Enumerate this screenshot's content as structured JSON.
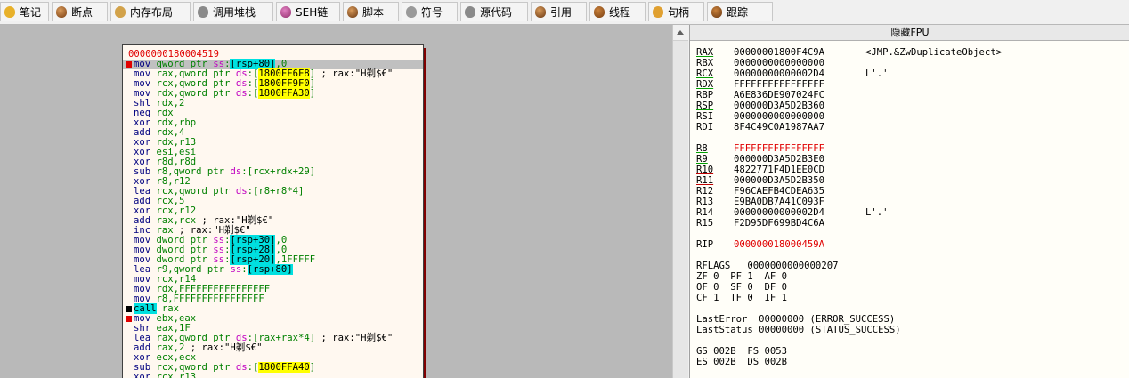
{
  "tabs": [
    {
      "label": "笔记",
      "icon": "note-icon"
    },
    {
      "label": "断点",
      "icon": "breakpoint-icon"
    },
    {
      "label": "内存布局",
      "icon": "memory-map-icon"
    },
    {
      "label": "调用堆栈",
      "icon": "call-stack-icon"
    },
    {
      "label": "SEH链",
      "icon": "seh-icon"
    },
    {
      "label": "脚本",
      "icon": "script-icon"
    },
    {
      "label": "符号",
      "icon": "symbols-icon"
    },
    {
      "label": "源代码",
      "icon": "source-icon"
    },
    {
      "label": "引用",
      "icon": "references-icon"
    },
    {
      "label": "线程",
      "icon": "threads-icon"
    },
    {
      "label": "句柄",
      "icon": "handles-icon"
    },
    {
      "label": "跟踪",
      "icon": "trace-icon"
    }
  ],
  "graph": {
    "address": "0000000180004519",
    "lines": [
      {
        "bp": "red",
        "hl": true,
        "parts": [
          [
            "mn",
            "mov "
          ],
          [
            "op",
            "qword ptr "
          ],
          [
            "sg",
            "ss"
          ],
          [
            "op",
            ":"
          ],
          [
            "br",
            "[rsp+80]"
          ],
          [
            "op",
            ",0"
          ]
        ]
      },
      {
        "parts": [
          [
            "mn",
            "mov "
          ],
          [
            "op",
            "rax,qword ptr "
          ],
          [
            "sg",
            "ds"
          ],
          [
            "op",
            ":["
          ],
          [
            "yl",
            "1800FF6F8"
          ],
          [
            "op",
            "]"
          ],
          [
            "cm",
            " ; rax:\"H剃$€\""
          ]
        ]
      },
      {
        "parts": [
          [
            "mn",
            "mov "
          ],
          [
            "op",
            "rcx,qword ptr "
          ],
          [
            "sg",
            "ds"
          ],
          [
            "op",
            ":["
          ],
          [
            "yl",
            "1800FF9F0"
          ],
          [
            "op",
            "]"
          ]
        ]
      },
      {
        "parts": [
          [
            "mn",
            "mov "
          ],
          [
            "op",
            "rdx,qword ptr "
          ],
          [
            "sg",
            "ds"
          ],
          [
            "op",
            ":["
          ],
          [
            "yl",
            "1800FFA30"
          ],
          [
            "op",
            "]"
          ]
        ]
      },
      {
        "parts": [
          [
            "mn",
            "shl "
          ],
          [
            "op",
            "rdx,2"
          ]
        ]
      },
      {
        "parts": [
          [
            "mn",
            "neg "
          ],
          [
            "op",
            "rdx"
          ]
        ]
      },
      {
        "parts": [
          [
            "mn",
            "xor "
          ],
          [
            "op",
            "rdx,rbp"
          ]
        ]
      },
      {
        "parts": [
          [
            "mn",
            "add "
          ],
          [
            "op",
            "rdx,4"
          ]
        ]
      },
      {
        "parts": [
          [
            "mn",
            "xor "
          ],
          [
            "op",
            "rdx,r13"
          ]
        ]
      },
      {
        "parts": [
          [
            "mn",
            "xor "
          ],
          [
            "op",
            "esi,esi"
          ]
        ]
      },
      {
        "parts": [
          [
            "mn",
            "xor "
          ],
          [
            "op",
            "r8d,r8d"
          ]
        ]
      },
      {
        "parts": [
          [
            "mn",
            "sub "
          ],
          [
            "op",
            "r8,qword ptr "
          ],
          [
            "sg",
            "ds"
          ],
          [
            "op",
            ":[rcx+rdx+29]"
          ]
        ]
      },
      {
        "parts": [
          [
            "mn",
            "xor "
          ],
          [
            "op",
            "r8,r12"
          ]
        ]
      },
      {
        "parts": [
          [
            "mn",
            "lea "
          ],
          [
            "op",
            "rcx,qword ptr "
          ],
          [
            "sg",
            "ds"
          ],
          [
            "op",
            ":[r8+r8*4]"
          ]
        ]
      },
      {
        "parts": [
          [
            "mn",
            "add "
          ],
          [
            "op",
            "rcx,5"
          ]
        ]
      },
      {
        "parts": [
          [
            "mn",
            "xor "
          ],
          [
            "op",
            "rcx,r12"
          ]
        ]
      },
      {
        "parts": [
          [
            "mn",
            "add "
          ],
          [
            "op",
            "rax,rcx"
          ],
          [
            "cm",
            " ; rax:\"H剃$€\""
          ]
        ]
      },
      {
        "parts": [
          [
            "mn",
            "inc "
          ],
          [
            "op",
            "rax"
          ],
          [
            "cm",
            " ; rax:\"H剃$€\""
          ]
        ]
      },
      {
        "parts": [
          [
            "mn",
            "mov "
          ],
          [
            "op",
            "dword ptr "
          ],
          [
            "sg",
            "ss"
          ],
          [
            "op",
            ":"
          ],
          [
            "br",
            "[rsp+30]"
          ],
          [
            "op",
            ",0"
          ]
        ]
      },
      {
        "parts": [
          [
            "mn",
            "mov "
          ],
          [
            "op",
            "dword ptr "
          ],
          [
            "sg",
            "ss"
          ],
          [
            "op",
            ":"
          ],
          [
            "br",
            "[rsp+28]"
          ],
          [
            "op",
            ",0"
          ]
        ]
      },
      {
        "parts": [
          [
            "mn",
            "mov "
          ],
          [
            "op",
            "dword ptr "
          ],
          [
            "sg",
            "ss"
          ],
          [
            "op",
            ":"
          ],
          [
            "br",
            "[rsp+20]"
          ],
          [
            "op",
            ",1FFFFF"
          ]
        ]
      },
      {
        "parts": [
          [
            "mn",
            "lea "
          ],
          [
            "op",
            "r9,qword ptr "
          ],
          [
            "sg",
            "ss"
          ],
          [
            "op",
            ":"
          ],
          [
            "br",
            "[rsp+80]"
          ]
        ]
      },
      {
        "parts": [
          [
            "mn",
            "mov "
          ],
          [
            "op",
            "rcx,r14"
          ]
        ]
      },
      {
        "parts": [
          [
            "mn",
            "mov "
          ],
          [
            "op",
            "rdx,FFFFFFFFFFFFFFFF"
          ]
        ]
      },
      {
        "parts": [
          [
            "mn",
            "mov "
          ],
          [
            "op",
            "r8,FFFFFFFFFFFFFFFF"
          ]
        ]
      },
      {
        "bp": "blk",
        "parts": [
          [
            "call",
            "call"
          ],
          [
            "op",
            " rax"
          ]
        ]
      },
      {
        "bp": "red",
        "parts": [
          [
            "mn",
            "mov "
          ],
          [
            "op",
            "ebx,eax"
          ]
        ]
      },
      {
        "parts": [
          [
            "mn",
            "shr "
          ],
          [
            "op",
            "eax,1F"
          ]
        ]
      },
      {
        "parts": [
          [
            "mn",
            "lea "
          ],
          [
            "op",
            "rax,qword ptr "
          ],
          [
            "sg",
            "ds"
          ],
          [
            "op",
            ":[rax+rax*4]"
          ],
          [
            "cm",
            " ; rax:\"H剃$€\""
          ]
        ]
      },
      {
        "parts": [
          [
            "mn",
            "add "
          ],
          [
            "op",
            "rax,2"
          ],
          [
            "cm",
            " ; rax:\"H剃$€\""
          ]
        ]
      },
      {
        "parts": [
          [
            "mn",
            "xor "
          ],
          [
            "op",
            "ecx,ecx"
          ]
        ]
      },
      {
        "parts": [
          [
            "mn",
            "sub "
          ],
          [
            "op",
            "rcx,qword ptr "
          ],
          [
            "sg",
            "ds"
          ],
          [
            "op",
            ":["
          ],
          [
            "yl",
            "1800FFA40"
          ],
          [
            "op",
            "]"
          ]
        ]
      },
      {
        "parts": [
          [
            "mn",
            "xor "
          ],
          [
            "op",
            "rcx,r13"
          ]
        ]
      }
    ]
  },
  "registers": {
    "header": "隐藏FPU",
    "rows": [
      {
        "name": "RAX",
        "value": "00000001800F4C9A",
        "comment": "<JMP.&ZwDuplicateObject>",
        "ul": "green"
      },
      {
        "name": "RBX",
        "value": "0000000000000000",
        "comment": ""
      },
      {
        "name": "RCX",
        "value": "00000000000002D4",
        "comment": "L'.'",
        "ul": "green"
      },
      {
        "name": "RDX",
        "value": "FFFFFFFFFFFFFFFF",
        "comment": "",
        "ul": "green"
      },
      {
        "name": "RBP",
        "value": "A6E836DE907024FC",
        "comment": ""
      },
      {
        "name": "RSP",
        "value": "000000D3A5D2B360",
        "comment": "",
        "ul": "green"
      },
      {
        "name": "RSI",
        "value": "0000000000000000",
        "comment": ""
      },
      {
        "name": "RDI",
        "value": "8F4C49C0A1987AA7",
        "comment": ""
      },
      {
        "gap": true
      },
      {
        "name": "R8",
        "value": "FFFFFFFFFFFFFFFF",
        "comment": "",
        "ul": "green",
        "red": true
      },
      {
        "name": "R9",
        "value": "000000D3A5D2B3E0",
        "comment": "",
        "ul": "green"
      },
      {
        "name": "R10",
        "value": "4822771F4D1EE0CD",
        "comment": "",
        "ul": "red"
      },
      {
        "name": "R11",
        "value": "000000D3A5D2B350",
        "comment": "",
        "ul": "red"
      },
      {
        "name": "R12",
        "value": "F96CAEFB4CDEA635",
        "comment": ""
      },
      {
        "name": "R13",
        "value": "E9BA0DB7A41C093F",
        "comment": ""
      },
      {
        "name": "R14",
        "value": "00000000000002D4",
        "comment": "L'.'"
      },
      {
        "name": "R15",
        "value": "F2D95DF699BD4C6A",
        "comment": ""
      },
      {
        "gap": true
      },
      {
        "name": "RIP",
        "value": "000000018000459A",
        "comment": "",
        "red": true
      },
      {
        "gap": true
      },
      {
        "text": "RFLAGS   0000000000000207"
      },
      {
        "text": "ZF 0  PF 1  AF 0"
      },
      {
        "text": "OF 0  SF 0  DF 0"
      },
      {
        "text": "CF 1  TF 0  IF 1"
      },
      {
        "gap": true
      },
      {
        "text": "LastError  00000000 (ERROR_SUCCESS)"
      },
      {
        "text": "LastStatus 00000000 (STATUS_SUCCESS)"
      },
      {
        "gap": true
      },
      {
        "text": "GS 002B  FS 0053"
      },
      {
        "text": "ES 002B  DS 002B"
      }
    ]
  }
}
